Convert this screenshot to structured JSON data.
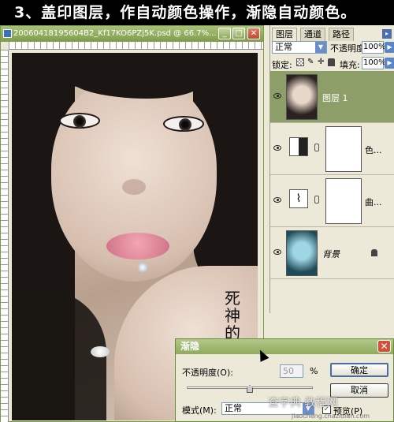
{
  "banner": {
    "text": "3、盖印图层，作自动颜色操作，渐隐自动颜色。"
  },
  "document": {
    "title": "20060418195604B2_Kf17KO6PZj5K.psd @ 66.7%...",
    "minimize": "_",
    "maximize": "□",
    "close": "✕",
    "signature_text": "死神的八"
  },
  "layers_panel": {
    "tabs": [
      "图层",
      "通道",
      "路径"
    ],
    "blend_mode": "正常",
    "opacity_label": "不透明度:",
    "opacity_value": "100%",
    "lock_label": "锁定:",
    "fill_label": "填充:",
    "fill_value": "100%",
    "layers": [
      {
        "name": "图层 1",
        "selected": true
      },
      {
        "name": "色...",
        "selected": false
      },
      {
        "name": "曲...",
        "selected": false
      },
      {
        "name": "背景",
        "selected": false
      }
    ]
  },
  "dialog": {
    "title": "渐隐",
    "opacity_label": "不透明度(O):",
    "opacity_value": "50",
    "percent": "%",
    "ok_label": "确定",
    "cancel_label": "取消",
    "mode_label": "模式(M):",
    "mode_value": "正常",
    "preview_label": "预览(P)",
    "preview_checked": true
  },
  "watermark": {
    "text": "查字典 教程网",
    "url": "jiaocheng.chazidian.com"
  },
  "colors": {
    "titlebar_green": "#8faa5c",
    "selected_layer": "#8e9e68",
    "banner_bg": "#000000"
  }
}
